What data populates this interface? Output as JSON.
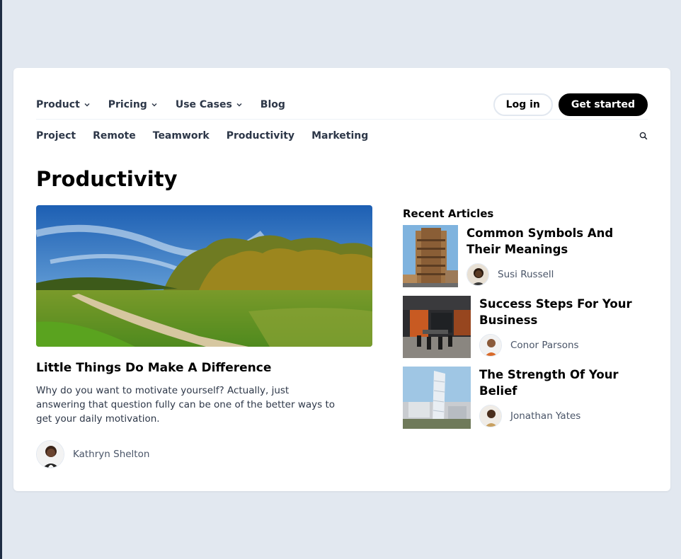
{
  "nav": {
    "items": [
      {
        "label": "Product",
        "has_dropdown": true
      },
      {
        "label": "Pricing",
        "has_dropdown": true
      },
      {
        "label": "Use Cases",
        "has_dropdown": true
      },
      {
        "label": "Blog",
        "has_dropdown": false
      }
    ],
    "login_label": "Log in",
    "get_started_label": "Get started"
  },
  "categories": [
    "Project",
    "Remote",
    "Teamwork",
    "Productivity",
    "Marketing"
  ],
  "page_title": "Productivity",
  "featured": {
    "title": "Little Things Do Make A Difference",
    "excerpt": "Why do you want to motivate yourself? Actually, just answering that question fully can be one of the better ways to get your daily motivation.",
    "author": "Kathryn Shelton",
    "image": "countryside-path-photo"
  },
  "recent": {
    "heading": "Recent Articles",
    "articles": [
      {
        "title": "Common Symbols And Their Meanings",
        "author": "Susi Russell",
        "image": "tall-building-photo"
      },
      {
        "title": "Success Steps For Your Business",
        "author": "Conor Parsons",
        "image": "office-interior-photo"
      },
      {
        "title": "The Strength Of Your Belief",
        "author": "Jonathan Yates",
        "image": "modern-tower-photo"
      }
    ]
  },
  "colors": {
    "background": "#e2e8f0",
    "card": "#ffffff",
    "button_dark": "#000000",
    "nav_text": "#2d3748"
  }
}
